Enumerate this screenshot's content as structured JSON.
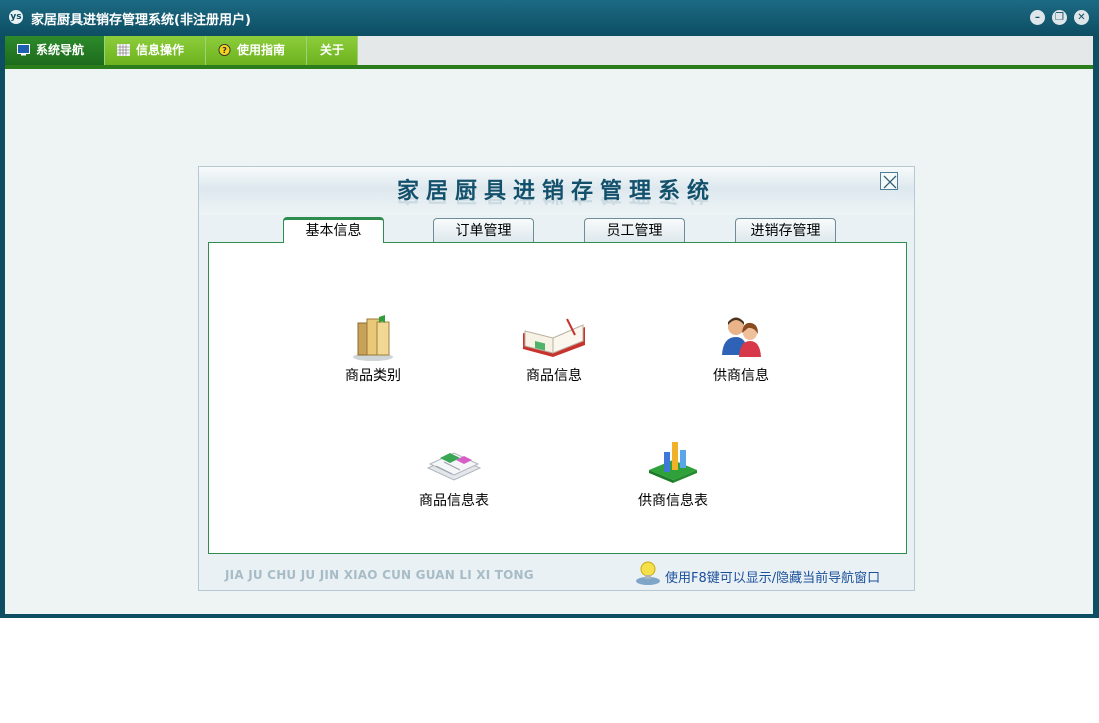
{
  "window": {
    "icon_text": "ys",
    "title": "家居厨具进销存管理系统(非注册用户)"
  },
  "menu": [
    {
      "label": "系统导航",
      "icon": "monitor-icon"
    },
    {
      "label": "信息操作",
      "icon": "grid-icon"
    },
    {
      "label": "使用指南",
      "icon": "help-icon"
    },
    {
      "label": "关于",
      "icon": ""
    }
  ],
  "nav": {
    "title": "家居厨具进销存管理系统",
    "tabs": [
      "基本信息",
      "订单管理",
      "员工管理",
      "进销存管理"
    ],
    "items": [
      {
        "label": "商品类别",
        "icon": "books-icon"
      },
      {
        "label": "商品信息",
        "icon": "open-book-icon"
      },
      {
        "label": "供商信息",
        "icon": "people-icon"
      },
      {
        "label": "商品信息表",
        "icon": "papers-icon"
      },
      {
        "label": "供商信息表",
        "icon": "chart-icon"
      }
    ],
    "footer_pinyin": "JIA JU CHU JU JIN XIAO CUN GUAN LI XI TONG",
    "footer_tip": "使用F8键可以显示/隐藏当前导航窗口"
  },
  "colors": {
    "titlebar": "#0d4e63",
    "menu_active": "#2d8a2a",
    "menu_normal": "#8ccd3a",
    "panel_border": "#2e8c4e",
    "nav_title": "#12506b"
  }
}
